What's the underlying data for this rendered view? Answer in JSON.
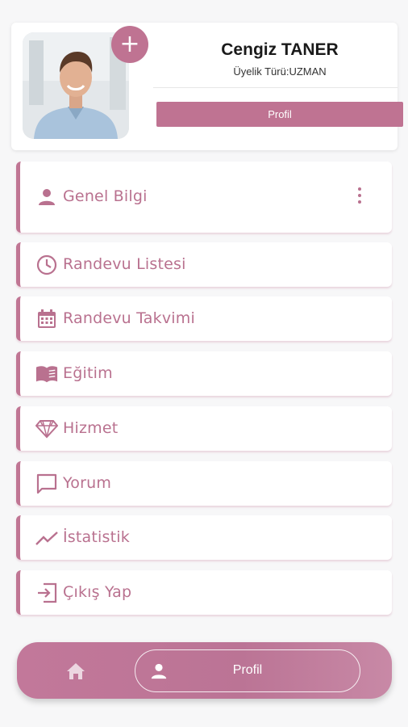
{
  "profile": {
    "name": "Cengiz TANER",
    "membership": "Üyelik Türü:UZMAN",
    "button_label": "Profil",
    "add_label": "+"
  },
  "menu": [
    {
      "label": "Genel Bilgi",
      "icon": "person-icon"
    },
    {
      "label": "Randevu Listesi",
      "icon": "clock-icon"
    },
    {
      "label": "Randevu Takvimi",
      "icon": "calendar-icon"
    },
    {
      "label": "Eğitim",
      "icon": "book-icon"
    },
    {
      "label": "Hizmet",
      "icon": "diamond-icon"
    },
    {
      "label": "Yorum",
      "icon": "comment-icon"
    },
    {
      "label": "İstatistik",
      "icon": "chart-icon"
    },
    {
      "label": "Çıkış Yap",
      "icon": "logout-icon"
    }
  ],
  "bottom_nav": {
    "active_label": "Profil",
    "home_icon": "home-icon",
    "profile_icon": "person-icon"
  },
  "colors": {
    "accent": "#bf7392",
    "text_accent": "#b9718f",
    "background": "#f7f7f8"
  }
}
